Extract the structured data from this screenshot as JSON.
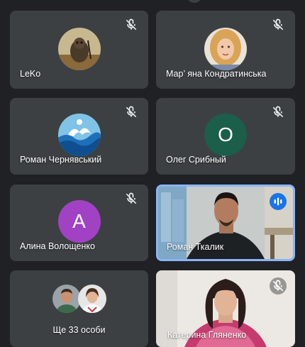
{
  "participants": [
    {
      "name": "LeKo",
      "mic": "muted",
      "avatar": "photo"
    },
    {
      "name": "Мар’ яна Кондратинська",
      "mic": "muted",
      "avatar": "photo"
    },
    {
      "name": "Роман Чернявський",
      "mic": "muted",
      "avatar": "photo"
    },
    {
      "name": "Олег Срибный",
      "mic": "muted",
      "avatar": "letter",
      "letter": "О",
      "color": "#1b5e49"
    },
    {
      "name": "Алина Волощенко",
      "mic": "muted",
      "avatar": "letter",
      "letter": "А",
      "color": "#a142c4"
    },
    {
      "name": "Роман Ткалик",
      "mic": "speaking",
      "avatar": "video"
    },
    {
      "name": "Катерина Гляненко",
      "mic": "muted",
      "avatar": "video"
    }
  ],
  "overflow": {
    "label": "Ще 33 особи"
  },
  "colors": {
    "background": "#202124",
    "tile": "#3c4043",
    "active_border": "#8ab4f8",
    "speaking_badge": "#1a73e8"
  }
}
